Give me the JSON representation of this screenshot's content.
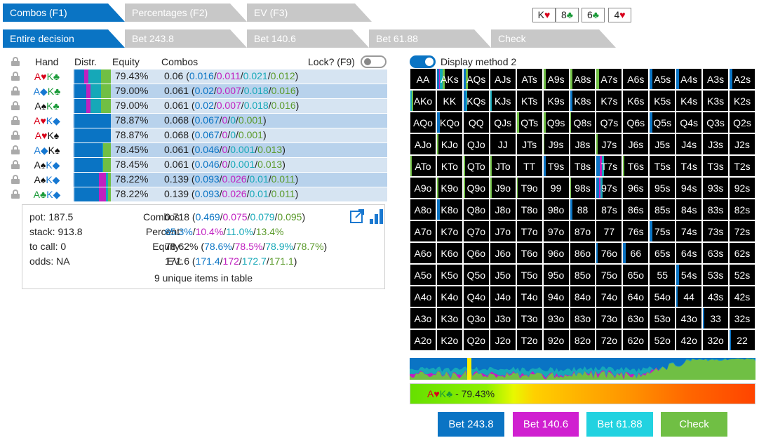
{
  "tabs_top": [
    {
      "label": "Combos (F1)",
      "active": true
    },
    {
      "label": "Percentages (F2)",
      "active": false
    },
    {
      "label": "EV (F3)",
      "active": false
    }
  ],
  "tabs_second": [
    {
      "label": "Entire decision",
      "active": true
    },
    {
      "label": "Bet 243.8",
      "active": false
    },
    {
      "label": "Bet 140.6",
      "active": false
    },
    {
      "label": "Bet 61.88",
      "active": false
    },
    {
      "label": "Check",
      "active": false
    }
  ],
  "board": [
    {
      "rank": "K",
      "suit": "♥",
      "color": "red"
    },
    {
      "rank": "8",
      "suit": "♣",
      "color": "grn"
    },
    {
      "rank": "6",
      "suit": "♣",
      "color": "grn"
    },
    {
      "rank": "4",
      "suit": "♥",
      "color": "red"
    }
  ],
  "table_header": {
    "hand": "Hand",
    "distr": "Distr.",
    "equity": "Equity",
    "combos": "Combos",
    "lock": "Lock? (F9)"
  },
  "rows": [
    {
      "hand": [
        {
          "r": "A",
          "s": "♥",
          "c": "red"
        },
        {
          "r": "K",
          "s": "♣",
          "c": "grn"
        }
      ],
      "dist": [
        0.27,
        0.12,
        0.35,
        0.26
      ],
      "equity": "79.43%",
      "combos": "0.06",
      "parts": [
        "0.016",
        "0.011",
        "0.021",
        "0.012"
      ]
    },
    {
      "hand": [
        {
          "r": "A",
          "s": "◆",
          "c": "blu"
        },
        {
          "r": "K",
          "s": "♣",
          "c": "grn"
        }
      ],
      "dist": [
        0.33,
        0.11,
        0.3,
        0.26
      ],
      "equity": "79.00%",
      "combos": "0.061",
      "parts": [
        "0.02",
        "0.007",
        "0.018",
        "0.016"
      ]
    },
    {
      "hand": [
        {
          "r": "A",
          "s": "♠",
          "c": "blk"
        },
        {
          "r": "K",
          "s": "♣",
          "c": "grn"
        }
      ],
      "dist": [
        0.33,
        0.11,
        0.3,
        0.26
      ],
      "equity": "79.00%",
      "combos": "0.061",
      "parts": [
        "0.02",
        "0.007",
        "0.018",
        "0.016"
      ]
    },
    {
      "hand": [
        {
          "r": "A",
          "s": "♥",
          "c": "red"
        },
        {
          "r": "K",
          "s": "◆",
          "c": "blu"
        }
      ],
      "dist": [
        1,
        0,
        0,
        0
      ],
      "equity": "78.87%",
      "combos": "0.068",
      "parts": [
        "0.067",
        "0",
        "0",
        "0.001"
      ]
    },
    {
      "hand": [
        {
          "r": "A",
          "s": "♥",
          "c": "red"
        },
        {
          "r": "K",
          "s": "♠",
          "c": "blk"
        }
      ],
      "dist": [
        1,
        0,
        0,
        0
      ],
      "equity": "78.87%",
      "combos": "0.068",
      "parts": [
        "0.067",
        "0",
        "0",
        "0.001"
      ]
    },
    {
      "hand": [
        {
          "r": "A",
          "s": "◆",
          "c": "blu"
        },
        {
          "r": "K",
          "s": "♠",
          "c": "blk"
        }
      ],
      "dist": [
        0.76,
        0,
        0.02,
        0.22
      ],
      "equity": "78.45%",
      "combos": "0.061",
      "parts": [
        "0.046",
        "0",
        "0.001",
        "0.013"
      ]
    },
    {
      "hand": [
        {
          "r": "A",
          "s": "♠",
          "c": "blk"
        },
        {
          "r": "K",
          "s": "◆",
          "c": "blu"
        }
      ],
      "dist": [
        0.76,
        0,
        0.02,
        0.22
      ],
      "equity": "78.45%",
      "combos": "0.061",
      "parts": [
        "0.046",
        "0",
        "0.001",
        "0.013"
      ]
    },
    {
      "hand": [
        {
          "r": "A",
          "s": "♠",
          "c": "blk"
        },
        {
          "r": "K",
          "s": "◆",
          "c": "blu"
        }
      ],
      "dist": [
        0.67,
        0.19,
        0.07,
        0.07
      ],
      "equity": "78.22%",
      "combos": "0.139",
      "parts": [
        "0.093",
        "0.026",
        "0.01",
        "0.011"
      ]
    },
    {
      "hand": [
        {
          "r": "A",
          "s": "♣",
          "c": "grn"
        },
        {
          "r": "K",
          "s": "◆",
          "c": "blu"
        }
      ],
      "dist": [
        0.67,
        0.19,
        0.07,
        0.07
      ],
      "equity": "78.22%",
      "combos": "0.139",
      "parts": [
        "0.093",
        "0.026",
        "0.01",
        "0.011"
      ]
    }
  ],
  "summary": {
    "pot_label": "pot:",
    "pot": "187.5",
    "stack_label": "stack:",
    "stack": "913.8",
    "tocall_label": "to call:",
    "tocall": "0",
    "odds_label": "odds:",
    "odds": "NA",
    "combos_label": "Combos:",
    "combos_total": "0.718",
    "combos_parts": [
      "0.469",
      "0.075",
      "0.079",
      "0.095"
    ],
    "percent_label": "Percent:",
    "percent_parts": [
      "65.3%",
      "10.4%",
      "11.0%",
      "13.4%"
    ],
    "equity_label": "Equity:",
    "equity_total": "78.62%",
    "equity_parts": [
      "78.6%",
      "78.5%",
      "78.9%",
      "78.7%"
    ],
    "ev_label": "EV:",
    "ev_total": "171.6",
    "ev_parts": [
      "171.4",
      "172",
      "172.7",
      "171.1"
    ],
    "unique": "9 unique items in table"
  },
  "display_method_label": "Display method 2",
  "ranks": [
    "A",
    "K",
    "Q",
    "J",
    "T",
    "9",
    "8",
    "7",
    "6",
    "5",
    "4",
    "3",
    "2"
  ],
  "colored_cells": {
    "AKs": [
      0.08,
      0.04,
      0.1,
      0.1
    ],
    "AQs": [
      0.08,
      0,
      0,
      0.1
    ],
    "A9s": [
      0,
      0,
      0,
      0.1
    ],
    "A8s": [
      0,
      0,
      0,
      0.1
    ],
    "A7s": [
      0,
      0,
      0,
      0.1
    ],
    "A5s": [
      0.1,
      0,
      0,
      0
    ],
    "A4s": [
      0.1,
      0,
      0,
      0
    ],
    "A2s": [
      0.1,
      0,
      0,
      0
    ],
    "AKo": [
      0,
      0,
      0.05,
      0.05
    ],
    "KQs": [
      0.1,
      0,
      0.05,
      0
    ],
    "KJs": [
      0,
      0,
      0.05,
      0
    ],
    "K8s": [
      0.1,
      0,
      0,
      0
    ],
    "KQo": [
      0.1,
      0,
      0,
      0
    ],
    "QTs": [
      0,
      0,
      0,
      0.1
    ],
    "Q9s": [
      0,
      0,
      0,
      0.1
    ],
    "Q8s": [
      0,
      0,
      0,
      0.05
    ],
    "Q5s": [
      0.1,
      0,
      0,
      0
    ],
    "KJo": [
      0,
      0,
      0,
      0.05
    ],
    "J9s": [
      0,
      0,
      0,
      0.05
    ],
    "J7s": [
      0,
      0,
      0,
      0.05
    ],
    "ATo": [
      0,
      0,
      0,
      0.05
    ],
    "QTo": [
      0,
      0,
      0,
      0.05
    ],
    "JTo": [
      0,
      0,
      0,
      0.05
    ],
    "T9s": [
      0.1,
      0,
      0,
      0
    ],
    "T7s": [
      0.12,
      0.08,
      0.1,
      0
    ],
    "T6s": [
      0,
      0,
      0,
      0.05
    ],
    "K9o": [
      0,
      0,
      0,
      0.05
    ],
    "Q9o": [
      0,
      0,
      0,
      0.05
    ],
    "J9o": [
      0,
      0,
      0,
      0.05
    ],
    "T9o": [
      0,
      0,
      0,
      0.05
    ],
    "98s": [
      0,
      0,
      0,
      0.05
    ],
    "97s": [
      0.1,
      0.05,
      0.1,
      0
    ],
    "K8o": [
      0.1,
      0,
      0,
      0
    ],
    "88": [
      0.1,
      0,
      0,
      0
    ],
    "75s": [
      0.1,
      0,
      0,
      0
    ],
    "76o": [
      0.05,
      0,
      0,
      0
    ],
    "66": [
      0.1,
      0,
      0,
      0
    ],
    "54s": [
      0.1,
      0,
      0,
      0
    ],
    "44": [
      0.05,
      0,
      0,
      0
    ],
    "33": [
      0.05,
      0,
      0,
      0
    ],
    "22": [
      0.05,
      0,
      0,
      0
    ]
  },
  "strategy_bar": {
    "blue": "#0a74c4",
    "magenta": "#c020c0",
    "cyan": "#16a8b8",
    "green": "#70bf44"
  },
  "equity_bar": {
    "label_hand": [
      {
        "r": "A",
        "s": "♥",
        "c": "red"
      },
      {
        "r": "K",
        "s": "♣",
        "c": "grn"
      }
    ],
    "label_value": " - 79.43%"
  },
  "buttons": [
    {
      "label": "Bet 243.8",
      "color": "#0a74c4"
    },
    {
      "label": "Bet 140.6",
      "color": "#d020d0"
    },
    {
      "label": "Bet 61.88",
      "color": "#22d2e0"
    },
    {
      "label": "Check",
      "color": "#70bf44"
    }
  ],
  "colors": {
    "bet_big": "#0a74c4",
    "bet_mid": "#c020c0",
    "bet_small": "#16a8b8",
    "check": "#70bf44",
    "row_a": "#b8d2ec",
    "row_b": "#d6e4f2"
  }
}
